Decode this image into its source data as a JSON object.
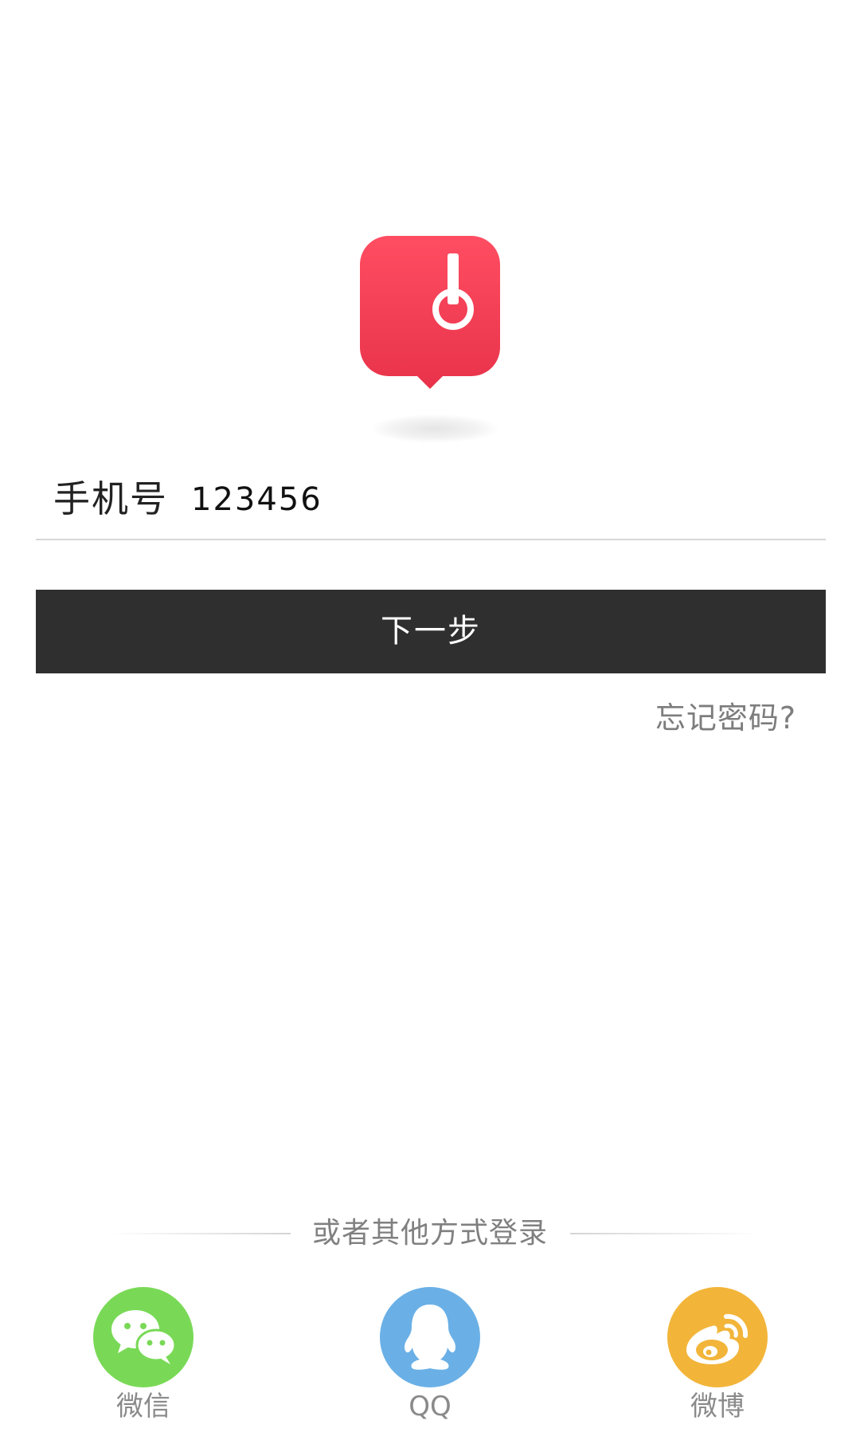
{
  "login": {
    "phone_label": "手机号",
    "phone_value": "123456",
    "next_button": "下一步",
    "forgot_password": "忘记密码?"
  },
  "social": {
    "divider_text": "或者其他方式登录",
    "items": [
      {
        "label": "微信",
        "icon": "wechat-icon",
        "color": "#79d956"
      },
      {
        "label": "QQ",
        "icon": "qq-icon",
        "color": "#6ab0e6"
      },
      {
        "label": "微博",
        "icon": "weibo-icon",
        "color": "#f2b53a"
      }
    ]
  },
  "colors": {
    "logo_red": "#f04458",
    "button_dark": "#2f2f2f"
  }
}
